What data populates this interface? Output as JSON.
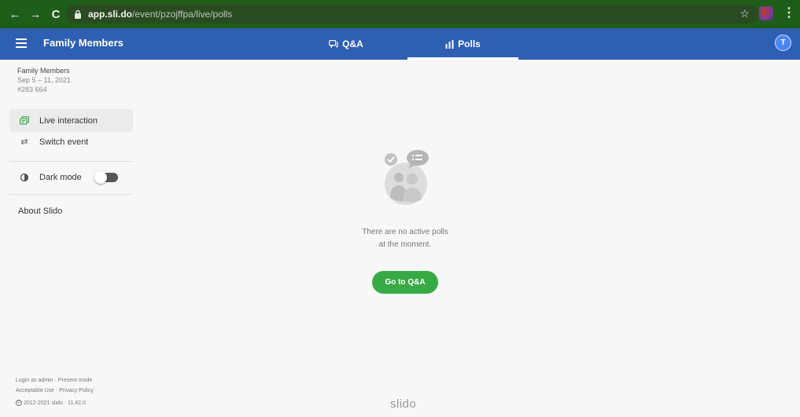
{
  "browser": {
    "url_domain": "app.sli.do",
    "url_path": "/event/pzojffpa/live/polls",
    "back": "←",
    "forward": "→",
    "reload": "C",
    "star": "☆"
  },
  "header": {
    "title": "Family Members",
    "tabs": [
      {
        "label": "Q&A",
        "icon": "chat-bubbles-icon"
      },
      {
        "label": "Polls",
        "icon": "bar-chart-icon",
        "active": true
      }
    ],
    "avatar_initial": "T"
  },
  "sidebar": {
    "event_name": "Family Members",
    "event_dates": "Sep 5 – 11, 2021",
    "event_code": "#283 664",
    "items": [
      {
        "label": "Live interaction",
        "icon": "live-interaction-icon"
      },
      {
        "label": "Switch event",
        "icon": "switch-arrows-icon"
      },
      {
        "label": "Dark mode",
        "icon": "contrast-icon"
      }
    ],
    "about": "About Slido",
    "footer": {
      "admin": "Login as admin",
      "present": "Present mode",
      "sep": " · ",
      "acceptable": "Acceptable Use",
      "privacy": "Privacy Policy",
      "copyright": "2012-2021 slido · 11.42.0"
    }
  },
  "main": {
    "empty_line1": "There are no active polls",
    "empty_line2": "at the moment.",
    "goto_button": "Go to Q&A",
    "brand": "slido"
  },
  "colors": {
    "header_blue": "#2f5fb3",
    "accent_green": "#37a945",
    "browser_green": "#1f5e1a"
  }
}
